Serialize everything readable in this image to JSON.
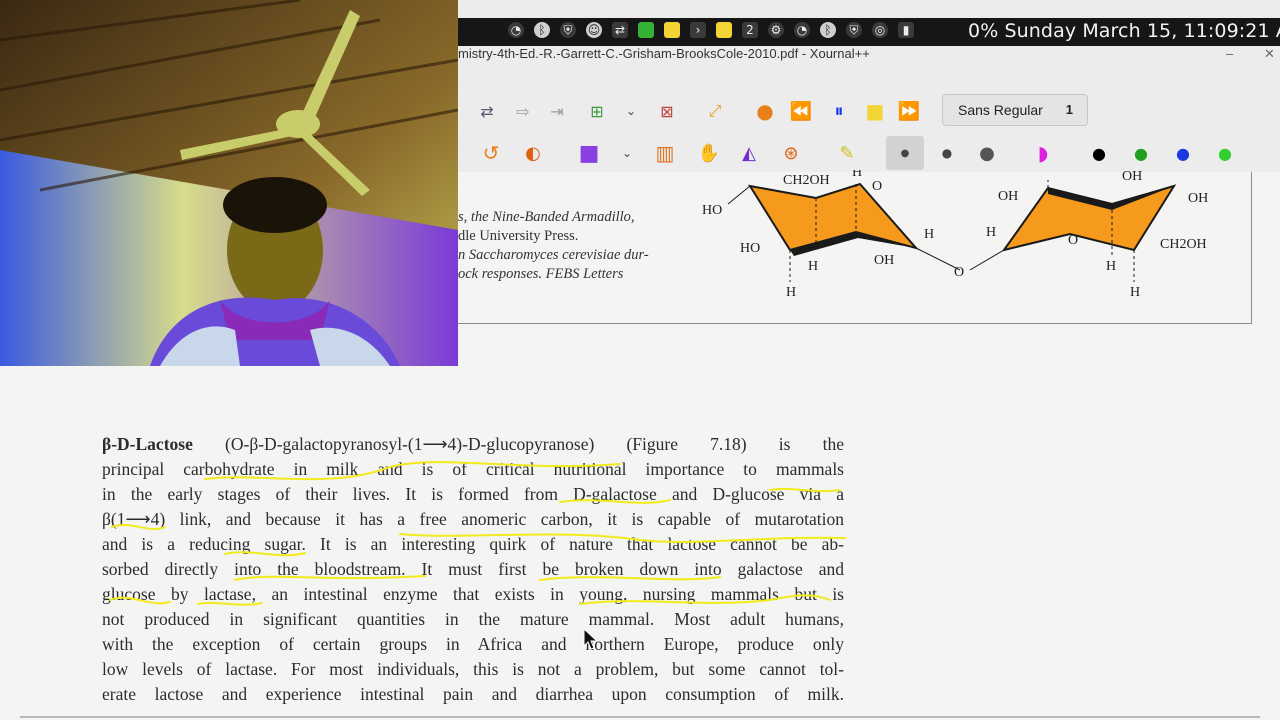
{
  "system_bar": {
    "status_text": "0% Sunday March 15, 11:09:21 A",
    "workspace_label": "2"
  },
  "window": {
    "title": "mistry-4th-Ed.-R.-Garrett-C.-Grisham-BrooksCole-2010.pdf - Xournal++"
  },
  "toolbar": {
    "font_name": "Sans Regular",
    "font_size": "1"
  },
  "document": {
    "references": [
      "s, the Nine-Banded Armadillo,",
      "dle University Press.",
      "n Saccharomyces cerevisiae dur-",
      "ock responses. FEBS Letters"
    ],
    "structure_labels": {
      "left_ring": [
        "CH2OH",
        "H",
        "O",
        "HO",
        "HO",
        "H",
        "OH",
        "H",
        "H"
      ],
      "linkage_o": "O",
      "right_ring": [
        "OH",
        "OH",
        "OH",
        "H",
        "O",
        "CH2OH",
        "H",
        "H"
      ]
    },
    "paragraph_lead": "β-D-Lactose",
    "paragraph_lines": [
      " (O-β-D-galactopyranosyl-(1⟶4)-D-glucopyranose) (Figure 7.18) is the",
      "principal carbohydrate in milk and is of critical nutritional importance to mammals",
      "in the early stages of their lives. It is formed from D-galactose and D-glucose via a",
      "β(1⟶4) link, and because it has a free anomeric carbon, it is capable of mutarotation",
      "and is a reducing sugar. It is an interesting quirk of nature that lactose cannot be ab-",
      "sorbed directly into the bloodstream. It must first be broken down into galactose and",
      "glucose by lactase, an intestinal enzyme that exists in young, nursing mammals but is",
      "not produced in significant quantities in the mature mammal. Most adult humans,",
      "with the exception of certain groups in Africa and northern Europe, produce only",
      "low levels of lactase. For most individuals, this is not a problem, but some cannot tol-",
      "erate lactose and experience intestinal pain and diarrhea upon consumption of milk."
    ]
  },
  "colors": {
    "highlighter": "#f2ea1c",
    "ring_fill": "#f59a1c",
    "topbar_bg": "#161616",
    "toolbar_bg": "#ececec"
  }
}
